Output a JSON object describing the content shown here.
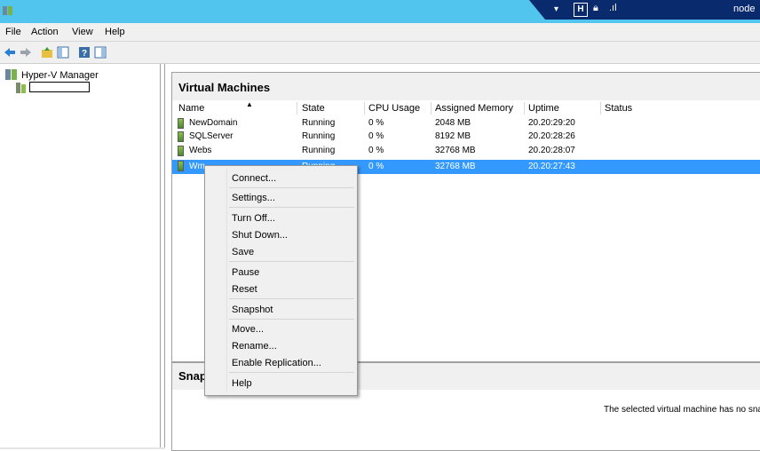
{
  "titlebar": {
    "app_icon": "hyperv-app-icon",
    "accent": "#52c5ee"
  },
  "rdp_bar": {
    "pin_icon": "pin-icon",
    "restore_icon": "restore-icon",
    "lock_icon": "lock-icon",
    "signal_icon": "signal-icon",
    "connection_label": "node"
  },
  "menu": {
    "file": "File",
    "action": "Action",
    "view": "View",
    "help": "Help"
  },
  "toolbar": {
    "buttons": [
      "back-icon",
      "forward-icon",
      "up-folder-icon",
      "console-tree-icon",
      "help-icon",
      "action-pane-icon"
    ]
  },
  "tree": {
    "root_label": "Hyper-V Manager",
    "child_label": ""
  },
  "vm_panel": {
    "title": "Virtual Machines",
    "columns": [
      "Name",
      "State",
      "CPU Usage",
      "Assigned Memory",
      "Uptime",
      "Status"
    ],
    "rows": [
      {
        "name": "NewDomain",
        "state": "Running",
        "cpu": "0 %",
        "memory": "2048 MB",
        "uptime": "20.20:29:20",
        "status": ""
      },
      {
        "name": "SQLServer",
        "state": "Running",
        "cpu": "0 %",
        "memory": "8192 MB",
        "uptime": "20.20:28:26",
        "status": ""
      },
      {
        "name": "Webs",
        "state": "Running",
        "cpu": "0 %",
        "memory": "32768 MB",
        "uptime": "20.20:28:07",
        "status": ""
      },
      {
        "name": "Wm",
        "state": "Running",
        "cpu": "0 %",
        "memory": "32768 MB",
        "uptime": "20.20:27:43",
        "status": "",
        "selected": true
      }
    ]
  },
  "snapshot_panel": {
    "title": "Snap",
    "message": "The selected virtual machine has no snaps"
  },
  "context_menu": {
    "items": [
      "Connect...",
      "Settings...",
      "Turn Off...",
      "Shut Down...",
      "Save",
      "Pause",
      "Reset",
      "Snapshot",
      "Move...",
      "Rename...",
      "Enable Replication...",
      "Help"
    ]
  },
  "colors": {
    "selection": "#3399ff",
    "title_bar": "#52c5ee",
    "rdp_bar": "#0a2a6e"
  }
}
